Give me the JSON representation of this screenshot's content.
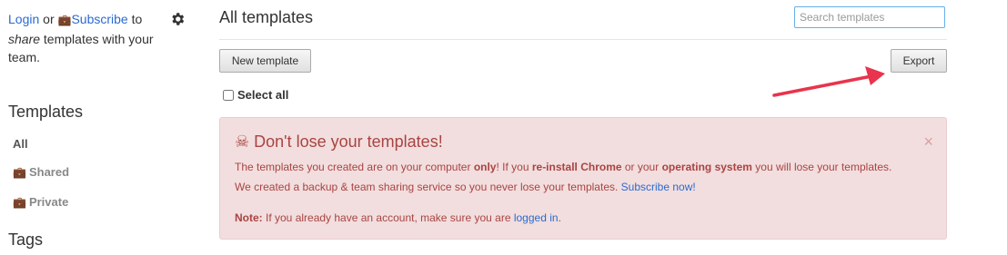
{
  "sidebar": {
    "login_link": "Login",
    "or_text": "or",
    "subscribe_link": "Subscribe",
    "to_text": "to",
    "share_text": "share",
    "rest_text": "templates with your team.",
    "templates_heading": "Templates",
    "nav": [
      {
        "label": "All",
        "icon": null
      },
      {
        "label": "Shared",
        "icon": "briefcase-icon"
      },
      {
        "label": "Private",
        "icon": "briefcase-icon"
      }
    ],
    "tags_heading": "Tags"
  },
  "main": {
    "title": "All templates",
    "search_placeholder": "Search templates",
    "new_template_label": "New template",
    "export_label": "Export",
    "select_all_label": "Select all"
  },
  "alert": {
    "title": "Don't lose your templates!",
    "line1_a": "The templates you created are on your computer ",
    "line1_b": "only",
    "line1_c": "! If you ",
    "line1_d": "re-install Chrome",
    "line1_e": " or your ",
    "line1_f": "operating system",
    "line1_g": " you will lose your templates.",
    "line2_a": "We created a backup & team sharing service so you never lose your templates. ",
    "line2_link": "Subscribe now!",
    "note_label": "Note:",
    "note_text": " If you already have an account, make sure you are ",
    "note_link": "logged in",
    "note_end": "."
  },
  "colors": {
    "link": "#2a6ad0",
    "alert_bg": "#f2dede",
    "alert_text": "#a94442",
    "arrow": "#e8344c",
    "briefcase": "#f0a30a"
  }
}
